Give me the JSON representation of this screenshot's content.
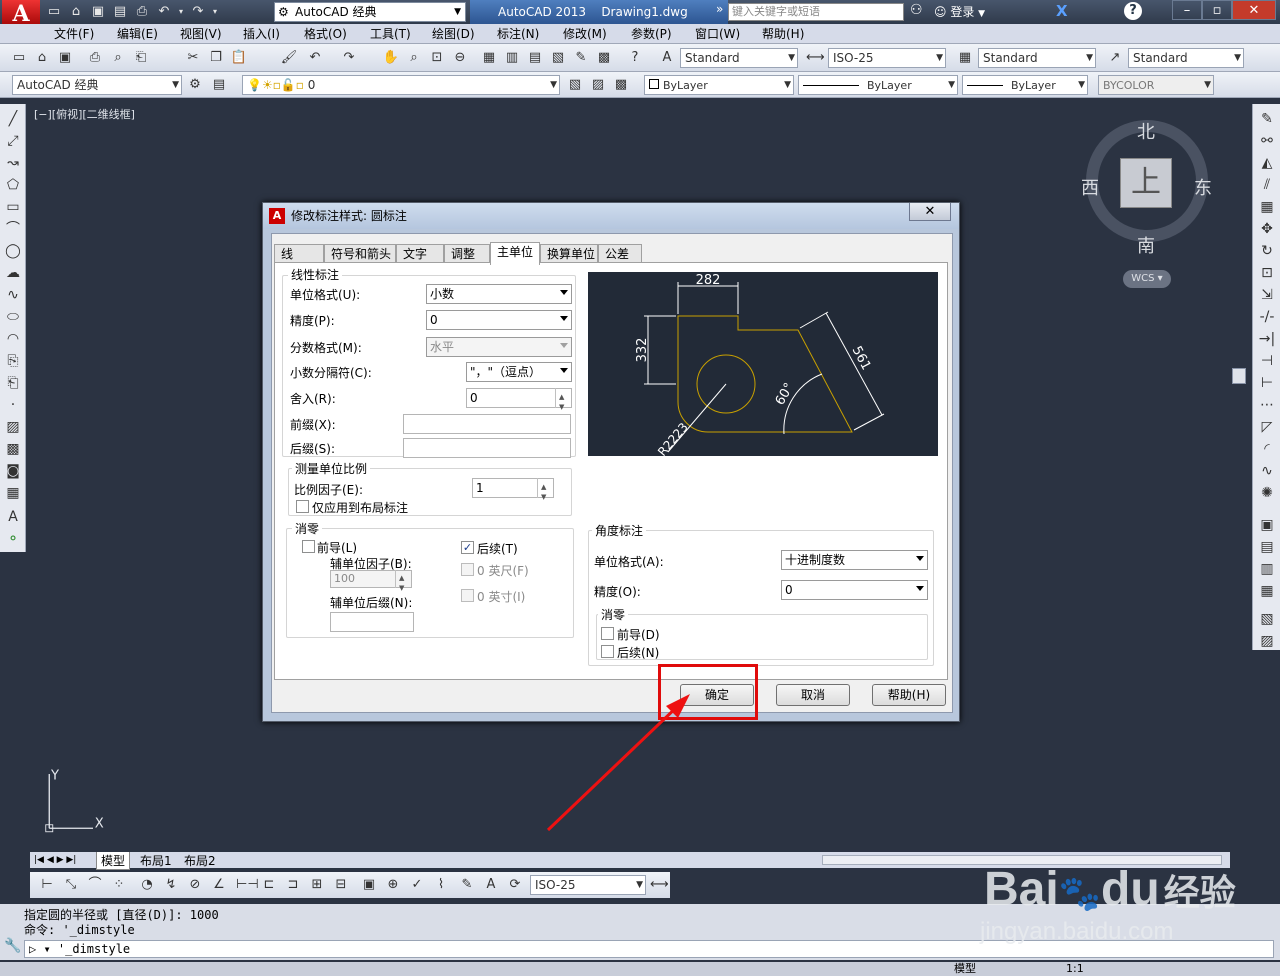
{
  "app": {
    "workspace": "AutoCAD 经典",
    "title_app": "AutoCAD 2013",
    "title_doc": "Drawing1.dwg",
    "search_placeholder": "键入关键字或短语",
    "login": "登录"
  },
  "menu": [
    "文件(F)",
    "编辑(E)",
    "视图(V)",
    "插入(I)",
    "格式(O)",
    "工具(T)",
    "绘图(D)",
    "标注(N)",
    "修改(M)",
    "参数(P)",
    "窗口(W)",
    "帮助(H)"
  ],
  "toolbar": {
    "text_style": "Standard",
    "dim_style": "ISO-25",
    "table_style": "Standard",
    "mleader_style": "Standard",
    "workspace": "AutoCAD 经典",
    "layer": "0",
    "color": "ByLayer",
    "linetype": "ByLayer",
    "lineweight": "ByLayer",
    "plotstyle": "BYCOLOR"
  },
  "viewport": {
    "label": "[−][俯视][二维线框]",
    "compass": {
      "n": "北",
      "s": "南",
      "e": "东",
      "w": "西",
      "face": "上"
    },
    "wcs": "WCS",
    "ucs_x": "X",
    "ucs_y": "Y"
  },
  "layout_tabs": [
    "模型",
    "布局1",
    "布局2"
  ],
  "dim_toolbar_style": "ISO-25",
  "command": {
    "line1": "指定圆的半径或 [直径(D)]: 1000",
    "line2": "命令: '_dimstyle",
    "prompt": "'_dimstyle"
  },
  "status": {
    "model": "模型",
    "scale": "1:1"
  },
  "dialog": {
    "title": "修改标注样式: 圆标注",
    "close": "✕",
    "tabs": [
      "线",
      "符号和箭头",
      "文字",
      "调整",
      "主单位",
      "换算单位",
      "公差"
    ],
    "active_tab": "主单位",
    "linear": {
      "title": "线性标注",
      "unit_format_label": "单位格式(U):",
      "unit_format": "小数",
      "precision_label": "精度(P):",
      "precision": "0",
      "fraction_label": "分数格式(M):",
      "fraction": "水平",
      "decimal_sep_label": "小数分隔符(C):",
      "decimal_sep": "\"，\"（逗点）",
      "round_label": "舍入(R):",
      "round": "0",
      "prefix_label": "前缀(X):",
      "suffix_label": "后缀(S):"
    },
    "scale": {
      "title": "测量单位比例",
      "factor_label": "比例因子(E):",
      "factor": "1",
      "layout_only_label": "仅应用到布局标注"
    },
    "zero": {
      "title": "消零",
      "leading_label": "前导(L)",
      "trailing_label": "后续(T)",
      "trailing_checked": "✓",
      "sub_factor_label": "辅单位因子(B):",
      "sub_factor": "100",
      "sub_suffix_label": "辅单位后缀(N):",
      "feet_label": "0 英尺(F)",
      "inch_label": "0 英寸(I)"
    },
    "angular": {
      "title": "角度标注",
      "unit_format_label": "单位格式(A):",
      "unit_format": "十进制度数",
      "precision_label": "精度(O):",
      "precision": "0",
      "zero_title": "消零",
      "leading_label": "前导(D)",
      "trailing_label": "后续(N)"
    },
    "preview": {
      "d1": "282",
      "d2": "332",
      "d3": "561",
      "angle": "60°",
      "radius": "R2223"
    },
    "buttons": {
      "ok": "确定",
      "cancel": "取消",
      "help": "帮助(H)"
    }
  },
  "watermark": {
    "brand": "Bai",
    "paw": "du",
    "jy": "经验",
    "url": "jingyan.baidu.com"
  }
}
